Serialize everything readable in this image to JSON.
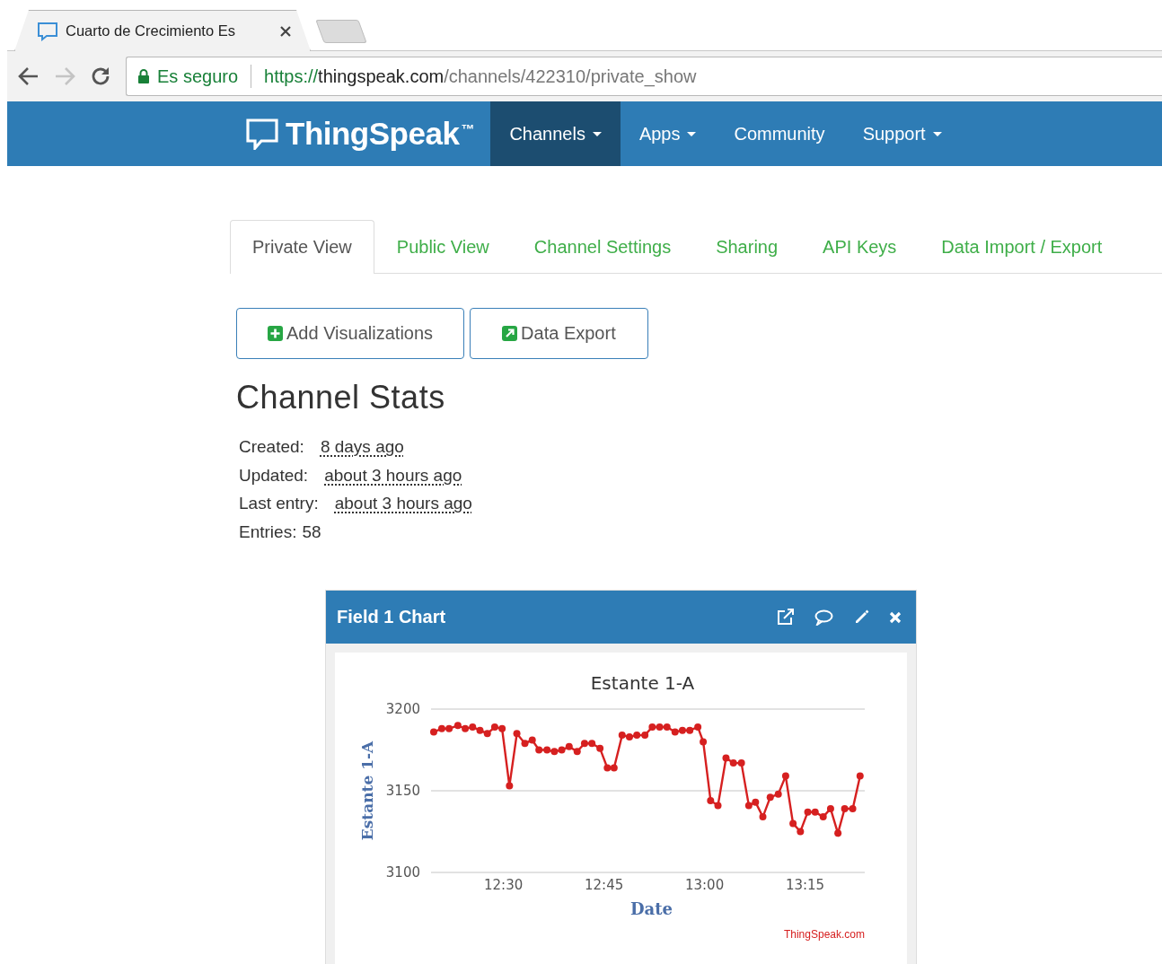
{
  "browser": {
    "tab_title": "Cuarto de Crecimiento Es",
    "secure_label": "Es seguro",
    "url_scheme": "https://",
    "url_host": "thingspeak.com",
    "url_path": "/channels/422310/private_show"
  },
  "navbar": {
    "brand": "ThingSpeak",
    "brand_mark": "™",
    "items": [
      {
        "label": "Channels",
        "dropdown": true,
        "selected": true
      },
      {
        "label": "Apps",
        "dropdown": true,
        "selected": false
      },
      {
        "label": "Community",
        "dropdown": false,
        "selected": false
      },
      {
        "label": "Support",
        "dropdown": true,
        "selected": false
      }
    ]
  },
  "tabs": [
    {
      "label": "Private View",
      "selected": true
    },
    {
      "label": "Public View",
      "selected": false
    },
    {
      "label": "Channel Settings",
      "selected": false
    },
    {
      "label": "Sharing",
      "selected": false
    },
    {
      "label": "API Keys",
      "selected": false
    },
    {
      "label": "Data Import / Export",
      "selected": false
    }
  ],
  "actions": [
    {
      "label": "Add Visualizations",
      "kind": "add"
    },
    {
      "label": "Data Export",
      "kind": "export"
    }
  ],
  "stats": {
    "heading": "Channel Stats",
    "rows": [
      {
        "label": "Created:",
        "value": "8 days ago",
        "underlined": true
      },
      {
        "label": "Updated:",
        "value": "about 3 hours ago",
        "underlined": true
      },
      {
        "label": "Last entry:",
        "value": "about 3 hours ago",
        "underlined": true
      },
      {
        "label": "Entries:",
        "value": "58",
        "underlined": false
      }
    ]
  },
  "chart_panel": {
    "title": "Field 1 Chart",
    "credit": "ThingSpeak.com",
    "chart_data": {
      "type": "line",
      "title": "Estante 1-A",
      "xlabel": "Date",
      "ylabel": "Estante 1-A",
      "x": [
        739.6,
        740.8,
        741.9,
        743.2,
        744.3,
        745.4,
        746.5,
        747.6,
        748.7,
        749.8,
        750.9,
        752.0,
        753.2,
        754.3,
        755.3,
        756.5,
        757.6,
        758.7,
        759.8,
        761.0,
        762.1,
        763.2,
        764.4,
        765.5,
        766.5,
        767.7,
        768.8,
        769.9,
        771.1,
        772.2,
        773.3,
        774.4,
        775.6,
        776.7,
        777.8,
        779.0,
        779.8,
        780.9,
        782.0,
        783.2,
        784.3,
        785.5,
        786.6,
        787.6,
        788.7,
        789.8,
        791.0,
        792.1,
        793.2,
        794.3,
        795.4,
        796.5,
        797.7,
        798.8,
        799.9,
        800.9,
        802.1,
        803.2
      ],
      "series": [
        {
          "color": "#d62020",
          "marker": true,
          "values": [
            3186,
            3188,
            3188,
            3190,
            3188,
            3189,
            3187,
            3185,
            3189,
            3188,
            3153,
            3185,
            3179,
            3181,
            3175,
            3175,
            3174,
            3175,
            3177,
            3174,
            3179,
            3179,
            3176,
            3164,
            3164,
            3184,
            3183,
            3184,
            3184,
            3189,
            3189,
            3189,
            3186,
            3187,
            3187,
            3189,
            3180,
            3144,
            3141,
            3170,
            3167,
            3167,
            3141,
            3143,
            3134,
            3146,
            3148,
            3159,
            3130,
            3125,
            3137,
            3137,
            3134,
            3139,
            3124,
            3139,
            3139,
            3159
          ]
        }
      ],
      "xlim": [
        739.2,
        803.9
      ],
      "ylim": [
        3100,
        3200
      ],
      "xticks": [
        {
          "value": 750,
          "label": "12:30"
        },
        {
          "value": 765,
          "label": "12:45"
        },
        {
          "value": 780,
          "label": "13:00"
        },
        {
          "value": 795,
          "label": "13:15"
        }
      ],
      "yticks": [
        3100,
        3150,
        3200
      ]
    }
  }
}
